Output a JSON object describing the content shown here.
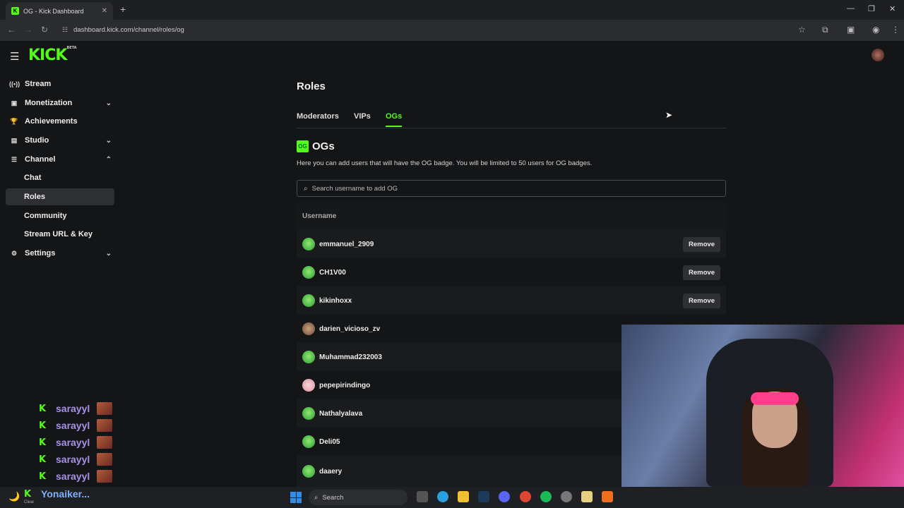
{
  "browser": {
    "tab_title": "OG - Kick Dashboard",
    "url": "dashboard.kick.com/channel/roles/og"
  },
  "sidebar": {
    "logo": "KICK",
    "logo_tag": "BETA",
    "items": [
      {
        "label": "Stream",
        "icon": "stream-icon"
      },
      {
        "label": "Monetization",
        "icon": "monetization-icon"
      },
      {
        "label": "Achievements",
        "icon": "trophy-icon"
      },
      {
        "label": "Studio",
        "icon": "studio-icon"
      },
      {
        "label": "Channel",
        "icon": "channel-icon"
      },
      {
        "label": "Settings",
        "icon": "gear-icon"
      }
    ],
    "channel_sub": [
      "Chat",
      "Roles",
      "Community",
      "Stream URL & Key"
    ],
    "active": "Roles"
  },
  "chat_overlay": {
    "messages": [
      "sarayyl",
      "sarayyl",
      "sarayyl",
      "sarayyl",
      "sarayyl"
    ],
    "bottom_user": "Yonaiker...",
    "clear_label": "Clear"
  },
  "page": {
    "title": "Roles",
    "tabs": [
      "Moderators",
      "VIPs",
      "OGs"
    ],
    "active_tab": "OGs",
    "section_title": "OGs",
    "section_icon_text": "OG",
    "description": "Here you can add users that will have the OG badge. You will be limited to 50 users for OG badges.",
    "search_placeholder": "Search username to add OG",
    "column_header": "Username",
    "remove_label": "Remove",
    "users": [
      "emmanuel_2909",
      "CH1V00",
      "kikinhoxx",
      "darien_vicioso_zv",
      "Muhammad232003",
      "pepepirindingo",
      "Nathalyalava",
      "Deli05",
      "daaery"
    ]
  },
  "taskbar": {
    "search_label": "Search"
  },
  "colors": {
    "accent": "#53fc18",
    "background": "#141517"
  }
}
